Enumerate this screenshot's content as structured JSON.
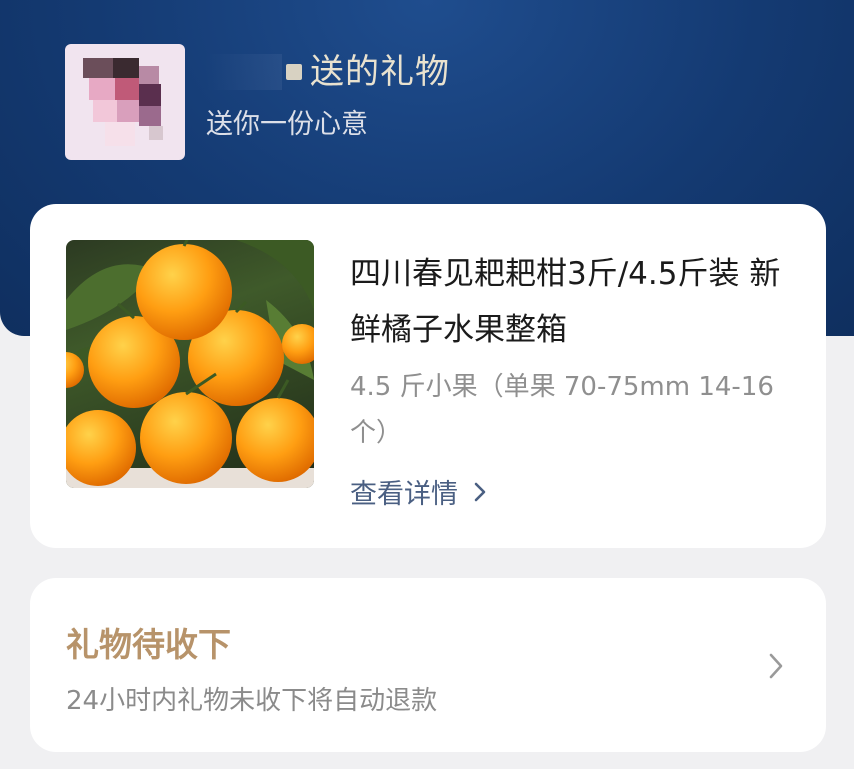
{
  "header": {
    "sender_title": "送的礼物",
    "sender_subtitle": "送你一份心意"
  },
  "product": {
    "title": "四川春见耙耙柑3斤/4.5斤装 新鲜橘子水果整箱",
    "spec": "4.5 斤小果（单果 70-75mm 14-16个）",
    "detail_link": "查看详情",
    "image_icon": "orange-fruit-photo"
  },
  "status": {
    "title": "礼物待收下",
    "description": "24小时内礼物未收下将自动退款"
  },
  "colors": {
    "header_bg": "#143a72",
    "status_title": "#b7936a",
    "link": "#4a5f82"
  }
}
